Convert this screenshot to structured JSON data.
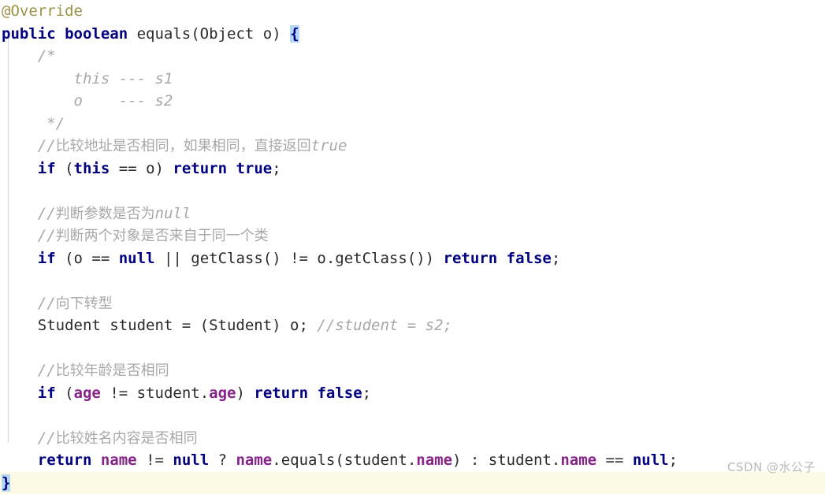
{
  "editor": {
    "language": "java",
    "theme": "intellij-light",
    "background_color": "#ffffff",
    "caret_line_color": "#fcfae4",
    "indent_guide_color": "#d8d8d8",
    "colors": {
      "annotation": "#9b9244",
      "keyword": "#000080",
      "plain": "#2b2b2b",
      "comment": "#a8a8a8",
      "field": "#87248a",
      "brace_match_background": "#b4d7f7"
    }
  },
  "code": {
    "lines": [
      {
        "id": "line-annotation-override",
        "tokens": [
          {
            "text": "@Override",
            "kind": "annotation"
          }
        ]
      },
      {
        "id": "line-method-signature",
        "tokens": [
          {
            "text": "public",
            "kind": "keyword"
          },
          {
            "text": " ",
            "kind": "plain"
          },
          {
            "text": "boolean",
            "kind": "keyword"
          },
          {
            "text": " equals(Object o) ",
            "kind": "plain"
          },
          {
            "text": "{",
            "kind": "brace-highlight"
          }
        ]
      },
      {
        "id": "line-block-comment-open",
        "tokens": [
          {
            "text": "    /*",
            "kind": "comment"
          }
        ]
      },
      {
        "id": "line-block-comment-this",
        "tokens": [
          {
            "text": "        this --- s1",
            "kind": "comment"
          }
        ]
      },
      {
        "id": "line-block-comment-o",
        "tokens": [
          {
            "text": "        o    --- s2",
            "kind": "comment"
          }
        ]
      },
      {
        "id": "line-block-comment-close",
        "tokens": [
          {
            "text": "     */",
            "kind": "comment"
          }
        ]
      },
      {
        "id": "line-comment-compare-address",
        "tokens": [
          {
            "text": "    //",
            "kind": "comment"
          },
          {
            "text": "比较地址是否相同，如果相同，直接返回",
            "kind": "comment-cjk"
          },
          {
            "text": "true",
            "kind": "comment"
          }
        ]
      },
      {
        "id": "line-if-this-equals-o",
        "tokens": [
          {
            "text": "    ",
            "kind": "plain"
          },
          {
            "text": "if",
            "kind": "keyword"
          },
          {
            "text": " (",
            "kind": "plain"
          },
          {
            "text": "this",
            "kind": "keyword"
          },
          {
            "text": " == o) ",
            "kind": "plain"
          },
          {
            "text": "return",
            "kind": "keyword"
          },
          {
            "text": " ",
            "kind": "plain"
          },
          {
            "text": "true",
            "kind": "keyword"
          },
          {
            "text": ";",
            "kind": "plain"
          }
        ]
      },
      {
        "id": "line-blank-1",
        "tokens": [
          {
            "text": " ",
            "kind": "plain"
          }
        ]
      },
      {
        "id": "line-comment-param-null",
        "tokens": [
          {
            "text": "    //",
            "kind": "comment"
          },
          {
            "text": "判断参数是否为",
            "kind": "comment-cjk"
          },
          {
            "text": "null",
            "kind": "comment"
          }
        ]
      },
      {
        "id": "line-comment-same-class",
        "tokens": [
          {
            "text": "    //",
            "kind": "comment"
          },
          {
            "text": "判断两个对象是否来自于同一个类",
            "kind": "comment-cjk"
          }
        ]
      },
      {
        "id": "line-if-null-or-class-mismatch",
        "tokens": [
          {
            "text": "    ",
            "kind": "plain"
          },
          {
            "text": "if",
            "kind": "keyword"
          },
          {
            "text": " (o == ",
            "kind": "plain"
          },
          {
            "text": "null",
            "kind": "keyword"
          },
          {
            "text": " || getClass() != o.getClass()) ",
            "kind": "plain"
          },
          {
            "text": "return",
            "kind": "keyword"
          },
          {
            "text": " ",
            "kind": "plain"
          },
          {
            "text": "false",
            "kind": "keyword"
          },
          {
            "text": ";",
            "kind": "plain"
          }
        ]
      },
      {
        "id": "line-blank-2",
        "tokens": [
          {
            "text": " ",
            "kind": "plain"
          }
        ]
      },
      {
        "id": "line-comment-downcast",
        "tokens": [
          {
            "text": "    //",
            "kind": "comment"
          },
          {
            "text": "向下转型",
            "kind": "comment-cjk"
          }
        ]
      },
      {
        "id": "line-downcast-student",
        "tokens": [
          {
            "text": "    Student student = (Student) o; ",
            "kind": "plain"
          },
          {
            "text": "//student = s2;",
            "kind": "comment"
          }
        ]
      },
      {
        "id": "line-blank-3",
        "tokens": [
          {
            "text": " ",
            "kind": "plain"
          }
        ]
      },
      {
        "id": "line-comment-compare-age",
        "tokens": [
          {
            "text": "    //",
            "kind": "comment"
          },
          {
            "text": "比较年龄是否相同",
            "kind": "comment-cjk"
          }
        ]
      },
      {
        "id": "line-if-age-mismatch",
        "tokens": [
          {
            "text": "    ",
            "kind": "plain"
          },
          {
            "text": "if",
            "kind": "keyword"
          },
          {
            "text": " (",
            "kind": "plain"
          },
          {
            "text": "age",
            "kind": "field-bold"
          },
          {
            "text": " != student.",
            "kind": "plain"
          },
          {
            "text": "age",
            "kind": "field-bold"
          },
          {
            "text": ") ",
            "kind": "plain"
          },
          {
            "text": "return",
            "kind": "keyword"
          },
          {
            "text": " ",
            "kind": "plain"
          },
          {
            "text": "false",
            "kind": "keyword"
          },
          {
            "text": ";",
            "kind": "plain"
          }
        ]
      },
      {
        "id": "line-blank-4",
        "tokens": [
          {
            "text": " ",
            "kind": "plain"
          }
        ]
      },
      {
        "id": "line-comment-compare-name",
        "tokens": [
          {
            "text": "    //",
            "kind": "comment"
          },
          {
            "text": "比较姓名内容是否相同",
            "kind": "comment-cjk"
          }
        ]
      },
      {
        "id": "line-return-name-ternary",
        "tokens": [
          {
            "text": "    ",
            "kind": "plain"
          },
          {
            "text": "return",
            "kind": "keyword"
          },
          {
            "text": " ",
            "kind": "plain"
          },
          {
            "text": "name",
            "kind": "field-bold"
          },
          {
            "text": " != ",
            "kind": "plain"
          },
          {
            "text": "null",
            "kind": "keyword"
          },
          {
            "text": " ? ",
            "kind": "plain"
          },
          {
            "text": "name",
            "kind": "field-bold"
          },
          {
            "text": ".equals(student.",
            "kind": "plain"
          },
          {
            "text": "name",
            "kind": "field-bold"
          },
          {
            "text": ") : student.",
            "kind": "plain"
          },
          {
            "text": "name",
            "kind": "field-bold"
          },
          {
            "text": " == ",
            "kind": "plain"
          },
          {
            "text": "null",
            "kind": "keyword"
          },
          {
            "text": ";",
            "kind": "plain"
          }
        ]
      },
      {
        "id": "line-method-close-brace",
        "caret_line": true,
        "tokens": [
          {
            "text": "}",
            "kind": "brace-highlight"
          }
        ]
      }
    ]
  },
  "watermark": {
    "text": "CSDN @水公子"
  }
}
